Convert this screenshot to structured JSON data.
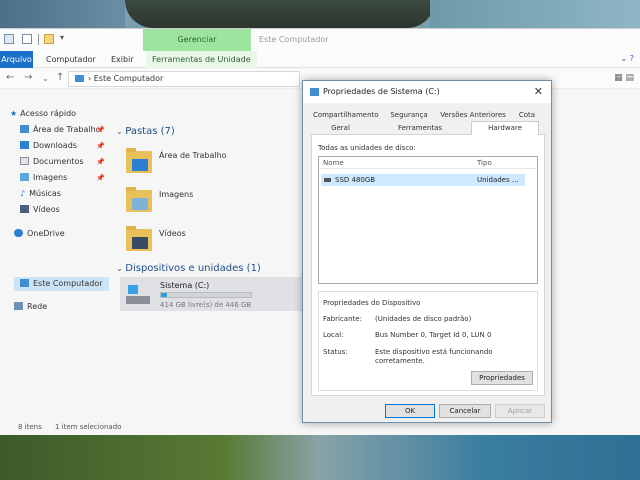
{
  "explorer": {
    "ribbon_context_header": "Gerenciar",
    "window_title": "Este Computador",
    "ribbon_tabs": {
      "file": "Arquivo",
      "computer": "Computador",
      "view": "Exibir",
      "drive_tools": "Ferramentas de Unidade"
    },
    "address": "Este Computador",
    "sidebar": {
      "quick_access": "Acesso rápido",
      "items": [
        "Área de Trabalho",
        "Downloads",
        "Documentos",
        "Imagens",
        "Músicas",
        "Vídeos"
      ],
      "onedrive": "OneDrive",
      "this_pc": "Este Computador",
      "network": "Rede"
    },
    "folders_header": "Pastas (7)",
    "folders": [
      "Área de Trabalho",
      "Imagens",
      "Vídeos"
    ],
    "devices_header": "Dispositivos e unidades (1)",
    "drive": {
      "label": "Sistema (C:)",
      "free": "414 GB livre(s) de 446 GB",
      "used_fraction": 0.07
    },
    "status": {
      "items": "8 itens",
      "selected": "1 item selecionado"
    }
  },
  "dialog": {
    "title": "Propriedades de Sistema (C:)",
    "tabs_row1": [
      "Compartilhamento",
      "Segurança",
      "Versões Anteriores",
      "Cota"
    ],
    "tabs_row2": [
      "Geral",
      "Ferramentas",
      "Hardware"
    ],
    "all_drives_label": "Todas as unidades de disco:",
    "list_headers": {
      "name": "Nome",
      "type": "Tipo"
    },
    "list_rows": [
      {
        "name": "SSD 480GB",
        "type": "Unidades ..."
      }
    ],
    "device_props_label": "Propriedades do Dispositivo",
    "manufacturer_label": "Fabricante:",
    "manufacturer_value": "(Unidades de disco padrão)",
    "location_label": "Local:",
    "location_value": "Bus Number 0, Target Id 0, LUN 0",
    "status_label": "Status:",
    "status_value_line1": "Este dispositivo está funcionando",
    "status_value_line2": "corretamente.",
    "properties_button": "Propriedades",
    "ok_button": "OK",
    "cancel_button": "Cancelar",
    "apply_button": "Aplicar"
  }
}
